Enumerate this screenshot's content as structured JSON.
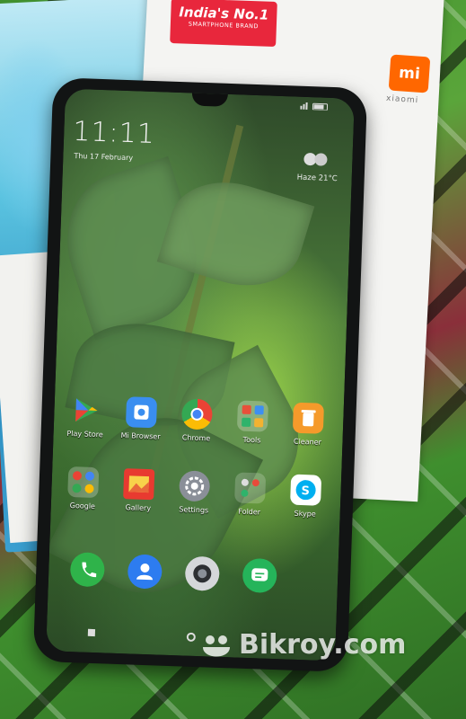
{
  "packaging": {
    "banner_title": "India's No.1",
    "banner_subtitle": "SMARTPHONE BRAND",
    "logo_text": "mi",
    "brand_word": "xiaomi"
  },
  "lockscreen": {
    "time": "11:11",
    "date": "Thu 17 February",
    "weather": "Haze  21°C"
  },
  "apps": [
    {
      "label": "Play Store",
      "icon": "play-store-icon"
    },
    {
      "label": "Mi Browser",
      "icon": "mi-browser-icon"
    },
    {
      "label": "Chrome",
      "icon": "chrome-icon"
    },
    {
      "label": "Tools",
      "icon": "tools-folder-icon"
    },
    {
      "label": "Cleaner",
      "icon": "cleaner-icon"
    },
    {
      "label": "Google",
      "icon": "google-folder-icon"
    },
    {
      "label": "Gallery",
      "icon": "gallery-icon"
    },
    {
      "label": "Settings",
      "icon": "settings-icon"
    },
    {
      "label": "Folder",
      "icon": "folder-icon"
    },
    {
      "label": "Skype",
      "icon": "skype-icon"
    }
  ],
  "dock": [
    {
      "icon": "phone-icon"
    },
    {
      "icon": "contacts-icon"
    },
    {
      "icon": "camera-icon"
    },
    {
      "icon": "messages-icon"
    }
  ],
  "watermark": "Bikroy.com",
  "colors": {
    "mi_orange": "#ff6700",
    "banner_red": "#e8273c"
  }
}
